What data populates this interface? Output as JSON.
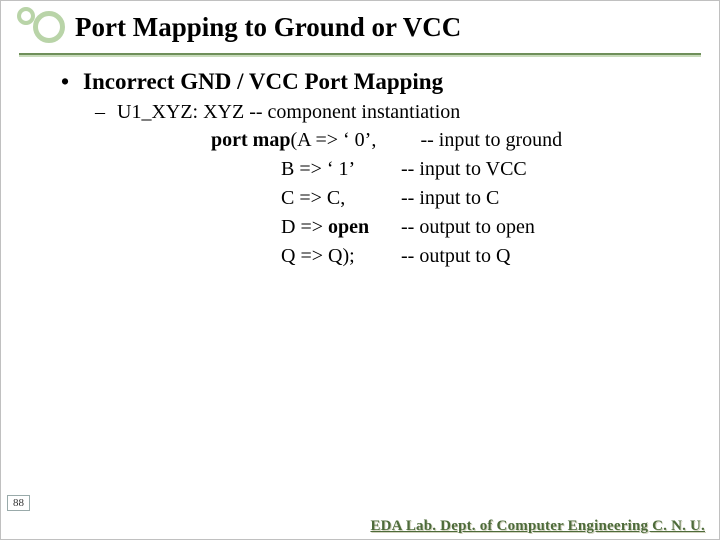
{
  "title": "Port Mapping to Ground or VCC",
  "bullet1": "Incorrect GND / VCC Port Mapping",
  "bullet2_prefix": "U1_XYZ: XYZ  -- component instantiation",
  "portmap_label": "port map",
  "rows": [
    {
      "map": "(A => ‘ 0’,",
      "note": "-- input to ground"
    },
    {
      "map": "  B => ‘ 1’",
      "note": "-- input to VCC"
    },
    {
      "map": "  C => C,",
      "note": "-- input to C"
    },
    {
      "map": "  D => open",
      "note": "-- output to open",
      "bold_val": "open"
    },
    {
      "map": "  Q => Q);",
      "note": "-- output to Q"
    }
  ],
  "page_number": "88",
  "footer": "EDA Lab. Dept. of Computer Engineering C. N. U."
}
